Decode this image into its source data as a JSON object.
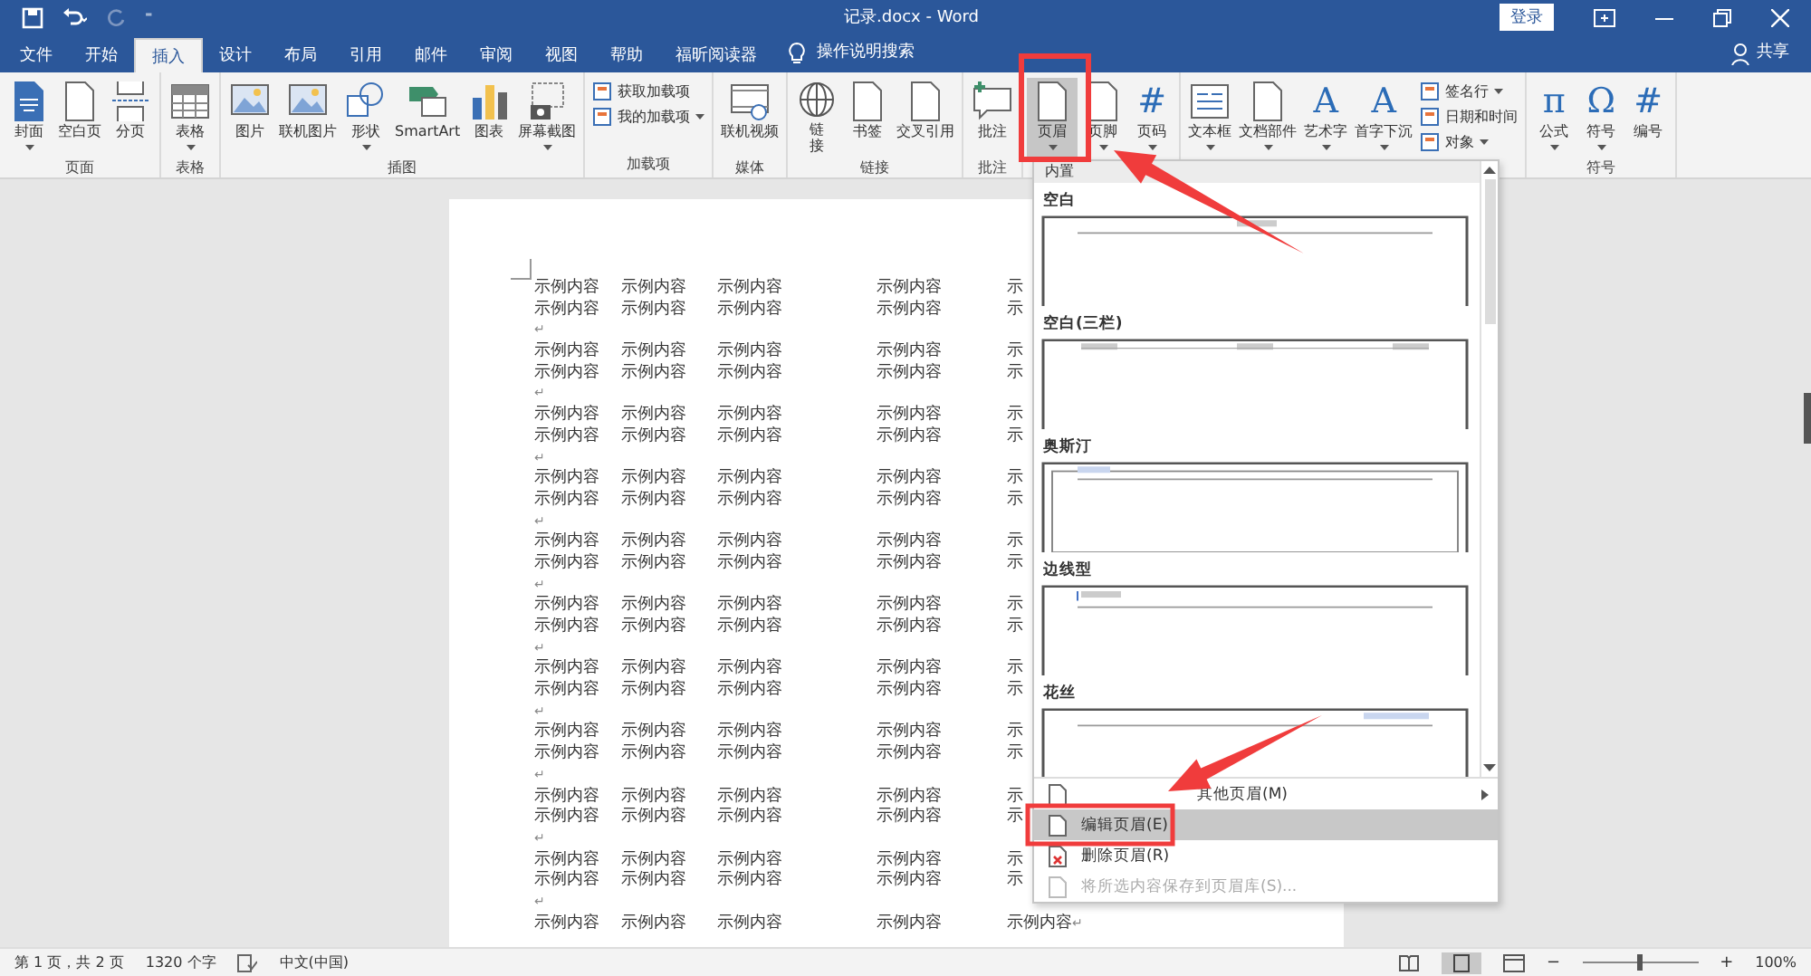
{
  "window": {
    "title": "记录.docx  -  Word",
    "sign_in": "登录",
    "share": "共享"
  },
  "quick_access": {
    "more": "⁼"
  },
  "tabs": [
    {
      "label": "文件",
      "selected": false
    },
    {
      "label": "开始",
      "selected": false
    },
    {
      "label": "插入",
      "selected": true
    },
    {
      "label": "设计",
      "selected": false
    },
    {
      "label": "布局",
      "selected": false
    },
    {
      "label": "引用",
      "selected": false
    },
    {
      "label": "邮件",
      "selected": false
    },
    {
      "label": "审阅",
      "selected": false
    },
    {
      "label": "视图",
      "selected": false
    },
    {
      "label": "帮助",
      "selected": false
    },
    {
      "label": "福昕阅读器",
      "selected": false
    }
  ],
  "tell_me": "操作说明搜索",
  "ribbon": [
    {
      "label": "页面",
      "buttons": [
        {
          "label": "封面",
          "menu": true,
          "selected": false
        },
        {
          "label": "空白页",
          "menu": false,
          "selected": false
        },
        {
          "label": "分页",
          "menu": false,
          "selected": false
        }
      ]
    },
    {
      "label": "表格",
      "buttons": [
        {
          "label": "表格",
          "menu": true,
          "selected": false
        }
      ]
    },
    {
      "label": "插图",
      "buttons": [
        {
          "label": "图片",
          "menu": false,
          "selected": false
        },
        {
          "label": "联机图片",
          "menu": false,
          "selected": false
        },
        {
          "label": "形状",
          "menu": true,
          "selected": false
        },
        {
          "label": "SmartArt",
          "menu": false,
          "selected": false
        },
        {
          "label": "图表",
          "menu": false,
          "selected": false
        },
        {
          "label": "屏幕截图",
          "menu": true,
          "selected": false
        }
      ]
    },
    {
      "label": "加载项",
      "small": [
        {
          "label": "获取加载项",
          "menu": false
        },
        {
          "label": "我的加载项",
          "menu": true
        }
      ]
    },
    {
      "label": "媒体",
      "buttons": [
        {
          "label": "联机视频",
          "menu": false,
          "selected": false
        }
      ]
    },
    {
      "label": "链接",
      "buttons": [
        {
          "label": "链接",
          "menu": false,
          "selected": false,
          "stacked": true
        },
        {
          "label": "书签",
          "menu": false,
          "selected": false
        },
        {
          "label": "交叉引用",
          "menu": false,
          "selected": false
        }
      ]
    },
    {
      "label": "批注",
      "buttons": [
        {
          "label": "批注",
          "menu": false,
          "selected": false
        }
      ]
    },
    {
      "buttons": [
        {
          "label": "页眉",
          "menu": true,
          "selected": true
        },
        {
          "label": "页脚",
          "menu": true,
          "selected": false
        },
        {
          "label": "页码",
          "menu": true,
          "selected": false,
          "glyph": "#"
        }
      ]
    },
    {
      "buttons": [
        {
          "label": "文本框",
          "menu": true,
          "selected": false
        },
        {
          "label": "文档部件",
          "menu": true,
          "selected": false
        },
        {
          "label": "艺术字",
          "menu": true,
          "selected": false,
          "glyph": "A"
        },
        {
          "label": "首字下沉",
          "menu": true,
          "selected": false,
          "glyph": "A"
        }
      ],
      "small": [
        {
          "label": "签名行",
          "menu": true
        },
        {
          "label": "日期和时间",
          "menu": false
        },
        {
          "label": "对象",
          "menu": true
        }
      ]
    },
    {
      "label": "符号",
      "buttons": [
        {
          "label": "公式",
          "menu": true,
          "selected": false,
          "glyph": "π"
        },
        {
          "label": "符号",
          "menu": true,
          "selected": false,
          "glyph": "Ω"
        },
        {
          "label": "编号",
          "menu": false,
          "selected": false,
          "glyph": "#"
        }
      ]
    }
  ],
  "document": {
    "lines": [
      {
        "cells": [
          "示例内容",
          "示例内容",
          "示例内容",
          "示例内容",
          "示"
        ]
      },
      {
        "cells": [
          "示例内容",
          "示例内容",
          "示例内容",
          "示例内容",
          "示"
        ]
      },
      {
        "mark": "↵"
      },
      {
        "cells": [
          "示例内容",
          "示例内容",
          "示例内容",
          "示例内容",
          "示"
        ]
      },
      {
        "cells": [
          "示例内容",
          "示例内容",
          "示例内容",
          "示例内容",
          "示"
        ]
      },
      {
        "mark": "↵"
      },
      {
        "cells": [
          "示例内容",
          "示例内容",
          "示例内容",
          "示例内容",
          "示"
        ]
      },
      {
        "cells": [
          "示例内容",
          "示例内容",
          "示例内容",
          "示例内容",
          "示"
        ]
      },
      {
        "mark": "↵"
      },
      {
        "cells": [
          "示例内容",
          "示例内容",
          "示例内容",
          "示例内容",
          "示"
        ]
      },
      {
        "cells": [
          "示例内容",
          "示例内容",
          "示例内容",
          "示例内容",
          "示"
        ]
      },
      {
        "mark": "↵"
      },
      {
        "cells": [
          "示例内容",
          "示例内容",
          "示例内容",
          "示例内容",
          "示"
        ]
      },
      {
        "cells": [
          "示例内容",
          "示例内容",
          "示例内容",
          "示例内容",
          "示"
        ]
      },
      {
        "mark": "↵"
      },
      {
        "cells": [
          "示例内容",
          "示例内容",
          "示例内容",
          "示例内容",
          "示"
        ]
      },
      {
        "cells": [
          "示例内容",
          "示例内容",
          "示例内容",
          "示例内容",
          "示"
        ]
      },
      {
        "mark": "↵"
      },
      {
        "cells": [
          "示例内容",
          "示例内容",
          "示例内容",
          "示例内容",
          "示"
        ]
      },
      {
        "cells": [
          "示例内容",
          "示例内容",
          "示例内容",
          "示例内容",
          "示"
        ]
      },
      {
        "mark": "↵"
      },
      {
        "cells": [
          "示例内容",
          "示例内容",
          "示例内容",
          "示例内容",
          "示"
        ]
      },
      {
        "cells": [
          "示例内容",
          "示例内容",
          "示例内容",
          "示例内容",
          "示"
        ]
      },
      {
        "mark": "↵"
      },
      {
        "cells": [
          "示例内容",
          "示例内容",
          "示例内容",
          "示例内容",
          "示"
        ]
      },
      {
        "cells": [
          "示例内容",
          "示例内容",
          "示例内容",
          "示例内容",
          "示"
        ]
      },
      {
        "mark": "↵"
      },
      {
        "cells": [
          "示例内容",
          "示例内容",
          "示例内容",
          "示例内容",
          "示"
        ]
      },
      {
        "cells": [
          "示例内容",
          "示例内容",
          "示例内容",
          "示例内容",
          "示"
        ]
      },
      {
        "mark": "↵"
      },
      {
        "cells": [
          "示例内容",
          "示例内容",
          "示例内容",
          "示例内容",
          "示例内容"
        ],
        "mark": "↵"
      }
    ]
  },
  "header_menu": {
    "section": "内置",
    "gallery": [
      {
        "label": "空白",
        "kind": "center"
      },
      {
        "label": "空白(三栏)",
        "kind": "three"
      },
      {
        "label": "奥斯汀",
        "kind": "framed"
      },
      {
        "label": "边线型",
        "kind": "left"
      },
      {
        "label": "花丝",
        "kind": "right"
      }
    ],
    "items": [
      {
        "label": "其他页眉(M)",
        "submenu": true,
        "selected": false,
        "disabled": false
      },
      {
        "label": "编辑页眉(E)",
        "submenu": false,
        "selected": true,
        "disabled": false
      },
      {
        "label": "删除页眉(R)",
        "submenu": false,
        "selected": false,
        "disabled": false
      },
      {
        "label": "将所选内容保存到页眉库(S)...",
        "submenu": false,
        "selected": false,
        "disabled": true
      }
    ]
  },
  "status_bar": {
    "page": "第 1 页，共 2 页",
    "words": "1320 个字",
    "language": "中文(中国)",
    "zoom_out": "−",
    "zoom_slider": {
      "level": 0.5
    },
    "zoom_in": "+",
    "zoom": "100%"
  }
}
